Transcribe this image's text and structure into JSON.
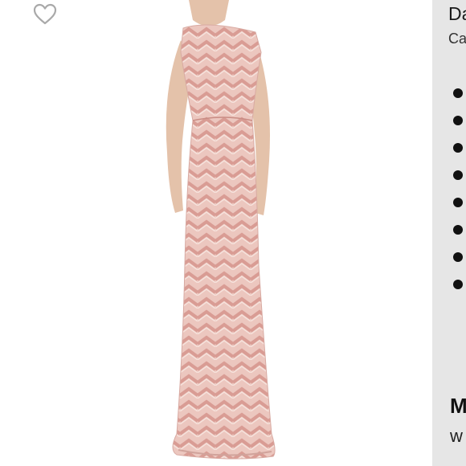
{
  "image_pane": {
    "like_icon": "heart-outline-icon",
    "like_color": "#a9a9a9",
    "gown_color": "#e7b9b0",
    "skin_color": "#e4c2aa"
  },
  "side_panel": {
    "brand_partial": "Da",
    "category_partial": "Ca",
    "bullet_count": 8,
    "section_heading_partial": "M",
    "section_sub_partial": "w"
  }
}
